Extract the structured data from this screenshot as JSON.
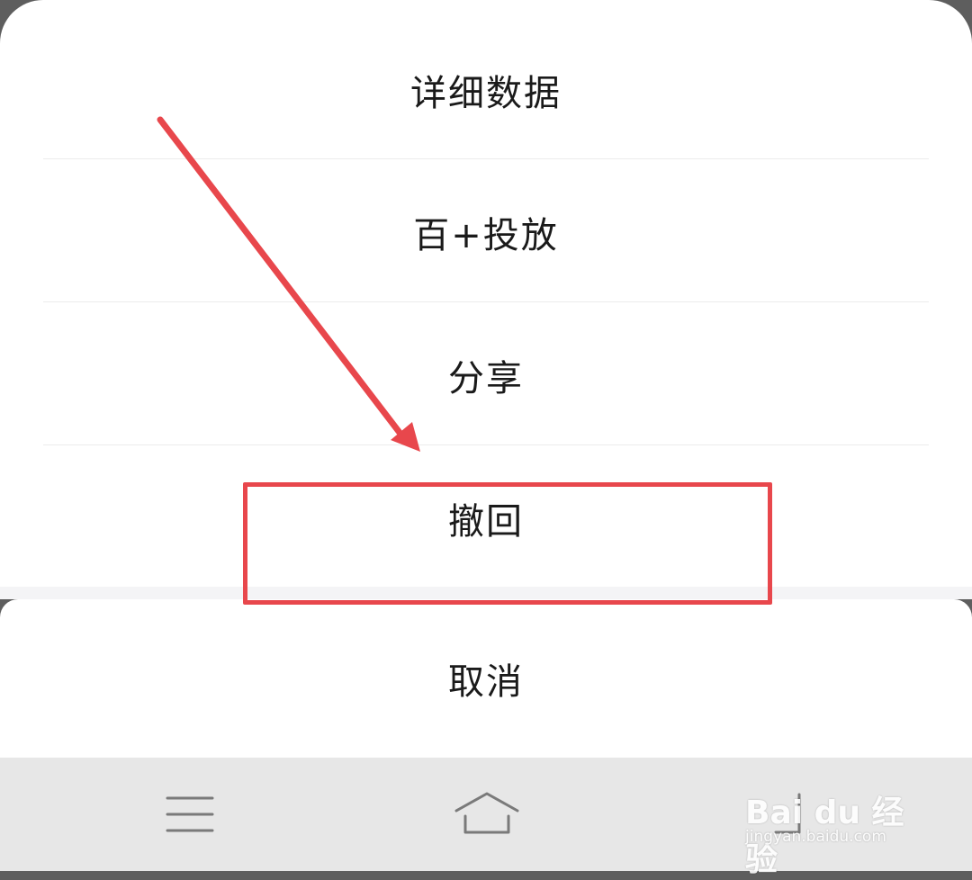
{
  "action_sheet": {
    "items": [
      {
        "label": "详细数据"
      },
      {
        "label": "百+投放"
      },
      {
        "label": "分享"
      },
      {
        "label": "撤回"
      }
    ],
    "cancel_label": "取消"
  },
  "nav_bar": {
    "menu_icon": "hamburger-menu-icon",
    "home_icon": "home-icon",
    "back_icon": "back-icon"
  },
  "annotation": {
    "arrow_color": "#e8474c",
    "highlight_color": "#e8474c",
    "highlighted_item": "撤回"
  },
  "watermark": {
    "logo_text": "Bai du 经验",
    "sub_text": "jingyan.baidu.com"
  }
}
